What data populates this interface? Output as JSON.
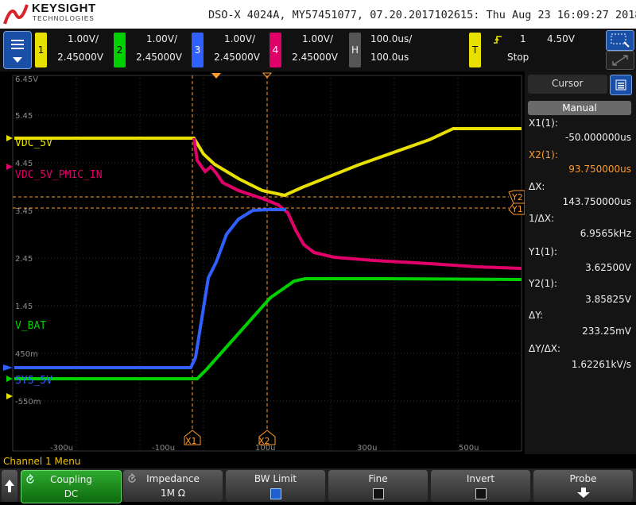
{
  "header": {
    "brand": "KEYSIGHT",
    "brand_sub": "TECHNOLOGIES",
    "title": "DSO-X 4024A, MY57451077, 07.20.2017102615: Thu Aug 23 16:09:27 2018"
  },
  "channels": [
    {
      "num": "1",
      "scale": "1.00V/",
      "offset": "2.45000V",
      "color": "#e8e000"
    },
    {
      "num": "2",
      "scale": "1.00V/",
      "offset": "2.45000V",
      "color": "#00d000"
    },
    {
      "num": "3",
      "scale": "1.00V/",
      "offset": "2.45000V",
      "color": "#3060ff"
    },
    {
      "num": "4",
      "scale": "1.00V/",
      "offset": "2.45000V",
      "color": "#e0006a"
    }
  ],
  "horizontal": {
    "key": "H",
    "scale": "100.0us/",
    "delay": "100.0us"
  },
  "trigger": {
    "key": "T",
    "source": "1",
    "level": "4.50V",
    "mode": "Stop"
  },
  "grid": {
    "y_labels": [
      "6.45V",
      "5.45",
      "4.45",
      "3.45",
      "2.45",
      "1.45",
      "450m",
      "-550m"
    ],
    "x_labels": [
      "-300u",
      "-100u",
      "100u",
      "300u",
      "500u"
    ]
  },
  "traces": {
    "labels": {
      "ch1": "VDC_5V",
      "ch4": "VDC_5V_PMIC_IN",
      "ch2": "V_BAT",
      "ch3": "SYS_5V"
    },
    "cursor_markers": {
      "x1": "X1",
      "x2": "X2",
      "y1": "Y1",
      "y2": "Y2"
    }
  },
  "cursor_panel": {
    "title": "Cursor",
    "mode": "Manual",
    "rows": [
      {
        "label": "X1(1):",
        "value": "-50.000000us",
        "color": "#eeeeee"
      },
      {
        "label": "X2(1):",
        "value": "93.750000us",
        "color": "#ff9a2a"
      },
      {
        "label": "ΔX:",
        "value": "143.750000us",
        "color": "#eeeeee"
      },
      {
        "label": "1/ΔX:",
        "value": "6.9565kHz",
        "color": "#eeeeee"
      },
      {
        "label": "Y1(1):",
        "value": "3.62500V",
        "color": "#eeeeee"
      },
      {
        "label": "Y2(1):",
        "value": "3.85825V",
        "color": "#eeeeee"
      },
      {
        "label": "ΔY:",
        "value": "233.25mV",
        "color": "#eeeeee"
      },
      {
        "label": "ΔY/ΔX:",
        "value": "1.62261kV/s",
        "color": "#eeeeee"
      }
    ]
  },
  "menu": {
    "title": "Channel 1 Menu",
    "softkeys": [
      {
        "l1": "Coupling",
        "l2": "DC"
      },
      {
        "l1": "Impedance",
        "l2": "1M Ω"
      },
      {
        "l1": "BW Limit",
        "l2": ""
      },
      {
        "l1": "Fine",
        "l2": ""
      },
      {
        "l1": "Invert",
        "l2": ""
      },
      {
        "l1": "Probe",
        "l2": ""
      }
    ]
  }
}
